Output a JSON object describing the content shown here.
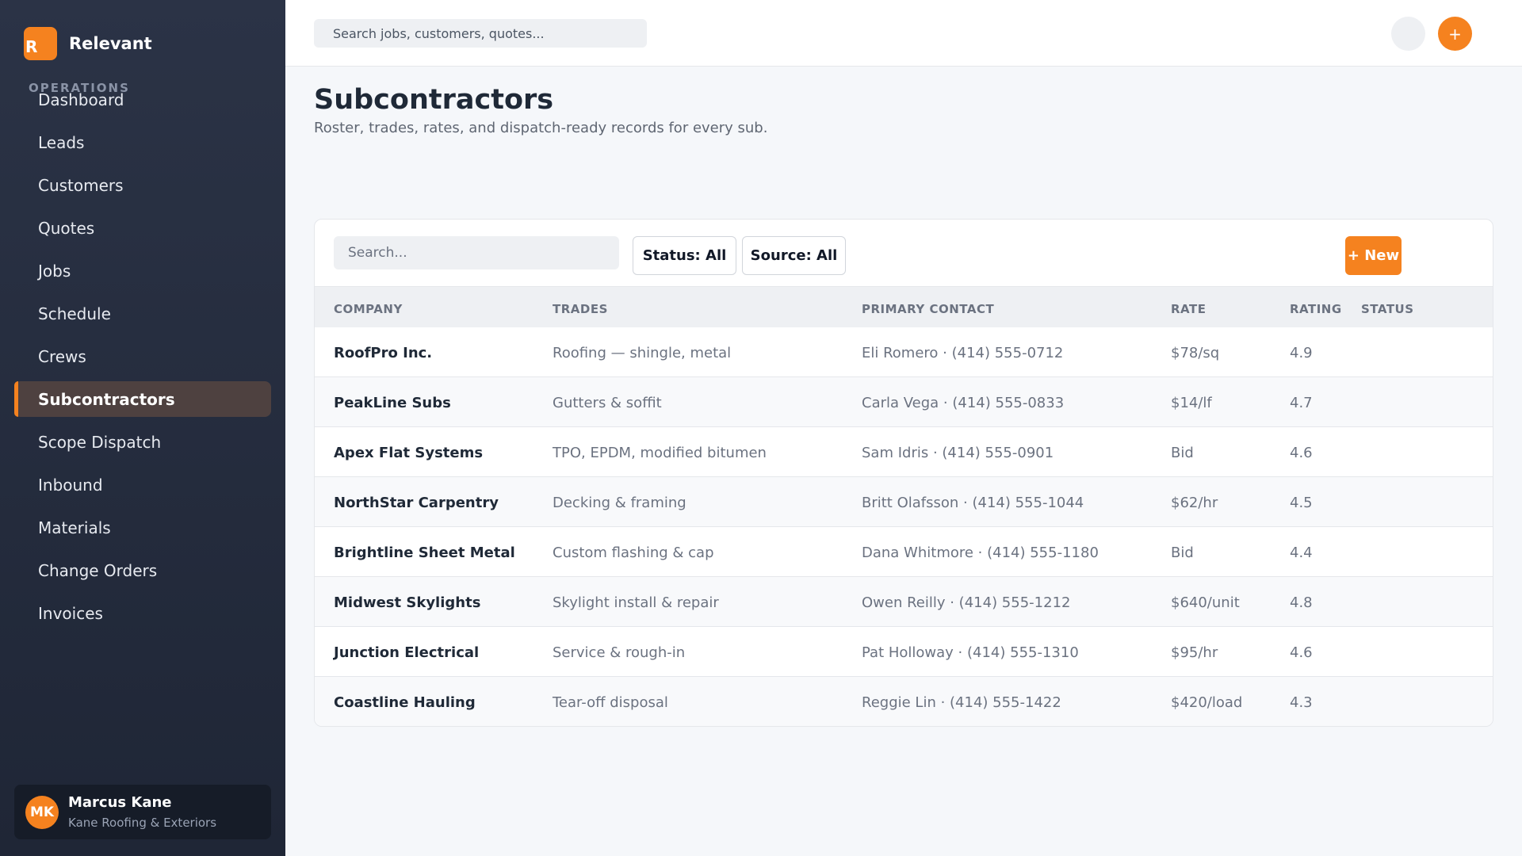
{
  "brand": {
    "logo_letter": "R",
    "name": "Relevant"
  },
  "sidebar": {
    "section_label": "OPERATIONS",
    "items": [
      {
        "label": "Dashboard",
        "active": false
      },
      {
        "label": "Leads",
        "active": false
      },
      {
        "label": "Customers",
        "active": false
      },
      {
        "label": "Quotes",
        "active": false
      },
      {
        "label": "Jobs",
        "active": false
      },
      {
        "label": "Schedule",
        "active": false
      },
      {
        "label": "Crews",
        "active": false
      },
      {
        "label": "Subcontractors",
        "active": true
      },
      {
        "label": "Scope Dispatch",
        "active": false
      },
      {
        "label": "Inbound",
        "active": false
      },
      {
        "label": "Materials",
        "active": false
      },
      {
        "label": "Change Orders",
        "active": false
      },
      {
        "label": "Invoices",
        "active": false
      }
    ],
    "user": {
      "initials": "MK",
      "name": "Marcus Kane",
      "company": "Kane Roofing & Exteriors"
    }
  },
  "topbar": {
    "search_placeholder": "Search jobs, customers, quotes...",
    "add_label": "+"
  },
  "page": {
    "title": "Subcontractors",
    "subtitle": "Roster, trades, rates, and dispatch-ready records for every sub."
  },
  "toolbar": {
    "search_placeholder": "Search...",
    "status_filter": "Status: All",
    "source_filter": "Source: All",
    "new_label": "+ New"
  },
  "table": {
    "columns": [
      "COMPANY",
      "TRADES",
      "PRIMARY CONTACT",
      "RATE",
      "RATING",
      "STATUS"
    ],
    "rows": [
      {
        "company": "RoofPro Inc.",
        "trades": "Roofing — shingle, metal",
        "contact": "Eli Romero · (414) 555-0712",
        "rate": "$78/sq",
        "rating": "4.9",
        "status": ""
      },
      {
        "company": "PeakLine Subs",
        "trades": "Gutters & soffit",
        "contact": "Carla Vega · (414) 555-0833",
        "rate": "$14/lf",
        "rating": "4.7",
        "status": ""
      },
      {
        "company": "Apex Flat Systems",
        "trades": "TPO, EPDM, modified bitumen",
        "contact": "Sam Idris · (414) 555-0901",
        "rate": "Bid",
        "rating": "4.6",
        "status": ""
      },
      {
        "company": "NorthStar Carpentry",
        "trades": "Decking & framing",
        "contact": "Britt Olafsson · (414) 555-1044",
        "rate": "$62/hr",
        "rating": "4.5",
        "status": ""
      },
      {
        "company": "Brightline Sheet Metal",
        "trades": "Custom flashing & cap",
        "contact": "Dana Whitmore · (414) 555-1180",
        "rate": "Bid",
        "rating": "4.4",
        "status": ""
      },
      {
        "company": "Midwest Skylights",
        "trades": "Skylight install & repair",
        "contact": "Owen Reilly · (414) 555-1212",
        "rate": "$640/unit",
        "rating": "4.8",
        "status": ""
      },
      {
        "company": "Junction Electrical",
        "trades": "Service & rough-in",
        "contact": "Pat Holloway · (414) 555-1310",
        "rate": "$95/hr",
        "rating": "4.6",
        "status": ""
      },
      {
        "company": "Coastline Hauling",
        "trades": "Tear-off disposal",
        "contact": "Reggie Lin · (414) 555-1422",
        "rate": "$420/load",
        "rating": "4.3",
        "status": ""
      }
    ]
  },
  "colors": {
    "accent": "#f5821f",
    "sidebar_bg": "#2b3346",
    "active_item_bg": "#4e4140"
  }
}
